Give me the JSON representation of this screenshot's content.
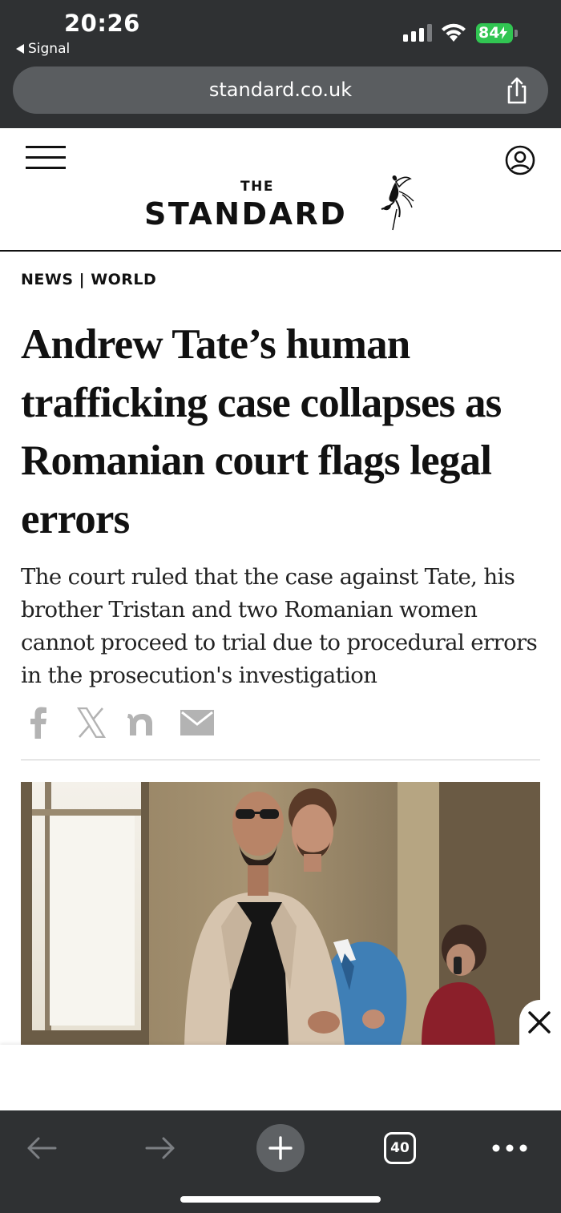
{
  "status_bar": {
    "time": "20:26",
    "back_app_label": "Signal",
    "battery_level": "84",
    "battery_charging": true,
    "signal_bars_active": 3,
    "signal_bars_total": 4
  },
  "browser": {
    "url": "standard.co.uk",
    "tab_count": "40"
  },
  "site": {
    "logo_small": "THE",
    "logo_main": "STANDARD"
  },
  "article": {
    "section": "NEWS | WORLD",
    "headline": "Andrew Tate’s human trafficking case collapses as Romanian court flags legal errors",
    "standfirst": "The court ruled that the case against Tate, his brother Tristan and two Romanian women cannot proceed to trial due to procedural errors in the prosecution's investigation",
    "share_icons": [
      "facebook-icon",
      "x-icon",
      "nextdoor-icon",
      "email-icon"
    ]
  },
  "colors": {
    "chrome_bg": "#2f3133",
    "url_bar_bg": "#5a5d60",
    "battery_green": "#31c552",
    "text_dark": "#111111",
    "share_icon_grey": "#b3b3b3"
  }
}
